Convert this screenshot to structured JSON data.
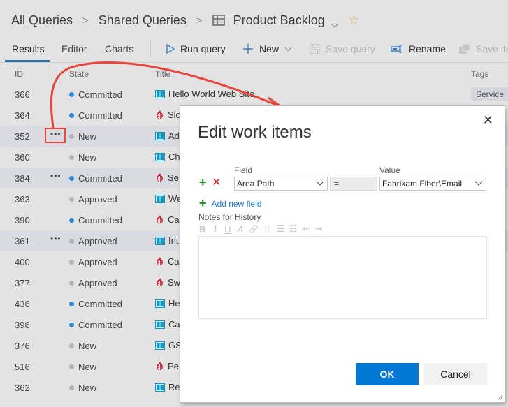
{
  "breadcrumb": {
    "items": [
      "All Queries",
      "Shared Queries",
      "Product Backlog"
    ],
    "separator": ">",
    "icons": {
      "query": "grid-icon",
      "dropdown": "chevron-down-icon",
      "favorite": "star-icon"
    },
    "star_glyph": "☆"
  },
  "toolbar": {
    "tabs": [
      {
        "label": "Results",
        "active": true
      },
      {
        "label": "Editor",
        "active": false
      },
      {
        "label": "Charts",
        "active": false
      }
    ],
    "actions": [
      {
        "label": "Run query",
        "icon": "play-icon",
        "enabled": true
      },
      {
        "label": "New",
        "icon": "plus-icon",
        "enabled": true,
        "dropdown": true
      },
      {
        "label": "Save query",
        "icon": "save-icon",
        "enabled": false
      },
      {
        "label": "Rename",
        "icon": "rename-icon",
        "enabled": true
      },
      {
        "label": "Save ite",
        "icon": "save-items-icon",
        "enabled": false
      }
    ]
  },
  "grid": {
    "columns": {
      "id": "ID",
      "state": "State",
      "title": "Title",
      "tags": "Tags"
    },
    "rows": [
      {
        "id": "366",
        "state": "Committed",
        "type": "story",
        "title": "Hello World Web Site",
        "tag": "Service",
        "selected": false,
        "more": false
      },
      {
        "id": "364",
        "state": "Committed",
        "type": "bug",
        "title": "Slo",
        "selected": false,
        "more": false
      },
      {
        "id": "352",
        "state": "New",
        "type": "story",
        "title": "Ad",
        "selected": true,
        "more": true
      },
      {
        "id": "360",
        "state": "New",
        "type": "story",
        "title": "Ch",
        "selected": false,
        "more": false
      },
      {
        "id": "384",
        "state": "Committed",
        "type": "bug",
        "title": "Se",
        "selected": true,
        "more": true
      },
      {
        "id": "363",
        "state": "Approved",
        "type": "story",
        "title": "We",
        "selected": false,
        "more": false
      },
      {
        "id": "390",
        "state": "Committed",
        "type": "bug",
        "title": "Ca",
        "selected": false,
        "more": false
      },
      {
        "id": "361",
        "state": "Approved",
        "type": "story",
        "title": "Int",
        "selected": true,
        "more": true
      },
      {
        "id": "400",
        "state": "Approved",
        "type": "bug",
        "title": "Ca",
        "selected": false,
        "more": false
      },
      {
        "id": "377",
        "state": "Approved",
        "type": "bug",
        "title": "Sw",
        "selected": false,
        "more": false
      },
      {
        "id": "436",
        "state": "Committed",
        "type": "story",
        "title": "He",
        "selected": false,
        "more": false
      },
      {
        "id": "396",
        "state": "Committed",
        "type": "story",
        "title": "Ca",
        "selected": false,
        "more": false
      },
      {
        "id": "376",
        "state": "New",
        "type": "story",
        "title": "GS",
        "selected": false,
        "more": false
      },
      {
        "id": "516",
        "state": "New",
        "type": "bug",
        "title": "Pe",
        "selected": false,
        "more": false
      },
      {
        "id": "362",
        "state": "New",
        "type": "story",
        "title": "Re",
        "selected": false,
        "more": false
      }
    ],
    "more_glyph": "•••",
    "state_colors": {
      "Committed": "#2b88d8",
      "New": "#b2b2b2",
      "Approved": "#b2b2b2"
    },
    "type_colors": {
      "story": "#009ccc",
      "bug": "#cc293d"
    }
  },
  "annotation": {
    "color": "#e8453c",
    "target": "more-actions-352"
  },
  "dialog": {
    "title": "Edit work items",
    "close_glyph": "✕",
    "field_label": "Field",
    "value_label": "Value",
    "field_value": "Area Path",
    "operator": "=",
    "value_value": "Fabrikam Fiber\\Email",
    "add_glyph": "+",
    "remove_glyph": "✕",
    "add_new_field": "Add new field",
    "notes_label": "Notes for History",
    "rte_tools": [
      {
        "name": "bold",
        "glyph": "B"
      },
      {
        "name": "italic",
        "glyph": "I"
      },
      {
        "name": "underline",
        "glyph": "U"
      },
      {
        "name": "highlight",
        "glyph": "A"
      },
      {
        "name": "link",
        "glyph": "🔗"
      },
      {
        "name": "unlink",
        "glyph": "⛓"
      },
      {
        "name": "bullet-list",
        "glyph": "☰"
      },
      {
        "name": "numbered-list",
        "glyph": "☷"
      },
      {
        "name": "outdent",
        "glyph": "⇤"
      },
      {
        "name": "indent",
        "glyph": "⇥"
      }
    ],
    "notes_value": "",
    "ok_label": "OK",
    "cancel_label": "Cancel",
    "ok_color": "#0078d4"
  }
}
